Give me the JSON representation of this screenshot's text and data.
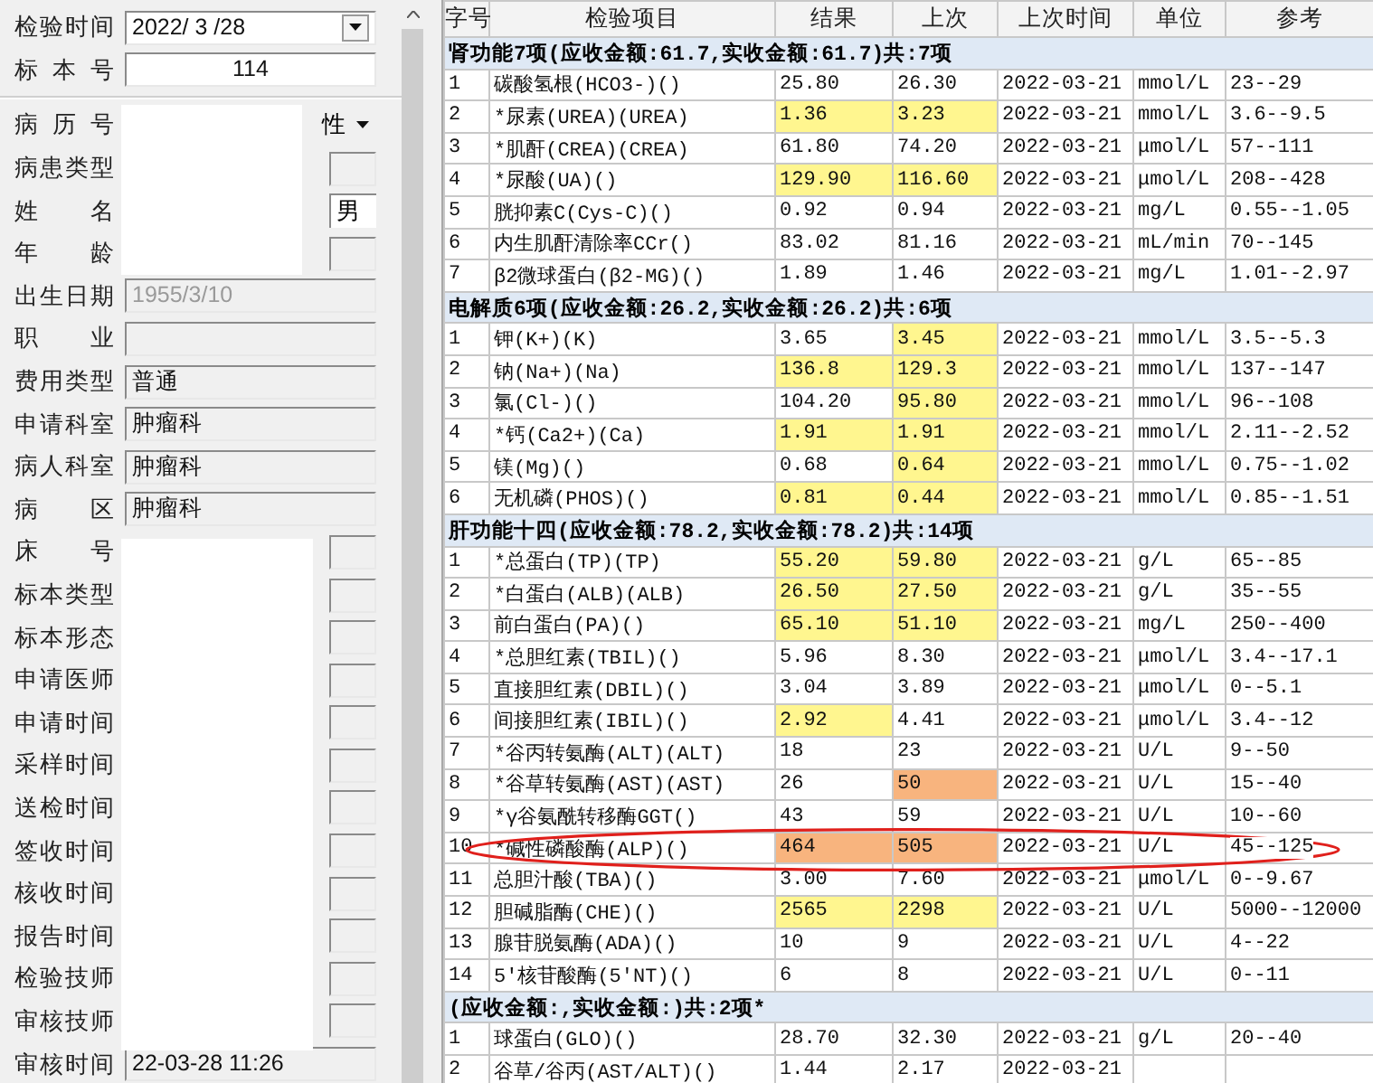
{
  "form": {
    "header_fields": [
      {
        "label": "检验时间",
        "value": "2022/ 3 /28",
        "kind": "dropdown"
      },
      {
        "label": "标 本 号",
        "value": "114",
        "kind": "number"
      }
    ],
    "fields": [
      {
        "label": "病 历 号",
        "kind": "sex_select",
        "sex_label": "性"
      },
      {
        "label": "病患类型",
        "kind": "redacted"
      },
      {
        "label": "姓 名",
        "kind": "name",
        "sex": "男"
      },
      {
        "label": "年 龄",
        "kind": "redacted"
      },
      {
        "label": "出生日期",
        "value": "1955/3/10",
        "kind": "disabled"
      },
      {
        "label": "职 业",
        "kind": "readonly"
      },
      {
        "label": "费用类型",
        "value": "普通",
        "kind": "readonly"
      },
      {
        "label": "申请科室",
        "value": "肿瘤科",
        "kind": "readonly"
      },
      {
        "label": "病人科室",
        "value": "肿瘤科",
        "kind": "readonly"
      },
      {
        "label": "病 区",
        "value": "肿瘤科",
        "kind": "readonly"
      },
      {
        "label": "床 号",
        "kind": "redacted"
      },
      {
        "label": "标本类型",
        "kind": "redacted"
      },
      {
        "label": "标本形态",
        "kind": "redacted"
      },
      {
        "label": "申请医师",
        "kind": "redacted"
      },
      {
        "label": "申请时间",
        "kind": "redacted"
      },
      {
        "label": "采样时间",
        "kind": "redacted"
      },
      {
        "label": "送检时间",
        "kind": "redacted"
      },
      {
        "label": "签收时间",
        "kind": "redacted"
      },
      {
        "label": "核收时间",
        "kind": "redacted"
      },
      {
        "label": "报告时间",
        "kind": "redacted"
      },
      {
        "label": "检验技师",
        "kind": "redacted"
      },
      {
        "label": "审核技师",
        "kind": "redacted"
      },
      {
        "label": "审核时间",
        "value": "22-03-28 11:26",
        "kind": "readonly"
      }
    ]
  },
  "table": {
    "columns": [
      "字号",
      "检验项目",
      "结果",
      "上次",
      "上次时间",
      "单位",
      "参考"
    ],
    "groups": [
      {
        "title": "肾功能7项(应收金额:61.7,实收金额:61.7)共:7项",
        "rows": [
          {
            "no": "1",
            "item": "碳酸氢根(HCO3-)()",
            "result": {
              "text": "25.80",
              "color": "#ffffff"
            },
            "previous": {
              "text": "26.30",
              "color": "#ffffff"
            },
            "previous_time": "2022-03-21",
            "unit": "mmol/L",
            "reference": "23--29",
            "circled": false
          },
          {
            "no": "2",
            "item": "*尿素(UREA)(UREA)",
            "result": {
              "text": "1.36",
              "color": "#fff68f"
            },
            "previous": {
              "text": "3.23",
              "color": "#fff68f"
            },
            "previous_time": "2022-03-21",
            "unit": "mmol/L",
            "reference": "3.6--9.5",
            "circled": false
          },
          {
            "no": "3",
            "item": "*肌酐(CREA)(CREA)",
            "result": {
              "text": "61.80",
              "color": "#ffffff"
            },
            "previous": {
              "text": "74.20",
              "color": "#ffffff"
            },
            "previous_time": "2022-03-21",
            "unit": "μmol/L",
            "reference": "57--111",
            "circled": false
          },
          {
            "no": "4",
            "item": "*尿酸(UA)()",
            "result": {
              "text": "129.90",
              "color": "#fff68f"
            },
            "previous": {
              "text": "116.60",
              "color": "#fff68f"
            },
            "previous_time": "2022-03-21",
            "unit": "μmol/L",
            "reference": "208--428",
            "circled": false
          },
          {
            "no": "5",
            "item": "胱抑素C(Cys-C)()",
            "result": {
              "text": "0.92",
              "color": "#ffffff"
            },
            "previous": {
              "text": "0.94",
              "color": "#ffffff"
            },
            "previous_time": "2022-03-21",
            "unit": "mg/L",
            "reference": "0.55--1.05",
            "circled": false
          },
          {
            "no": "6",
            "item": "内生肌酐清除率CCr()",
            "result": {
              "text": "83.02",
              "color": "#ffffff"
            },
            "previous": {
              "text": "81.16",
              "color": "#ffffff"
            },
            "previous_time": "2022-03-21",
            "unit": "mL/min",
            "reference": "70--145",
            "circled": false
          },
          {
            "no": "7",
            "item": "β2微球蛋白(β2-MG)()",
            "result": {
              "text": "1.89",
              "color": "#ffffff"
            },
            "previous": {
              "text": "1.46",
              "color": "#ffffff"
            },
            "previous_time": "2022-03-21",
            "unit": "mg/L",
            "reference": "1.01--2.97",
            "circled": false
          }
        ]
      },
      {
        "title": "电解质6项(应收金额:26.2,实收金额:26.2)共:6项",
        "rows": [
          {
            "no": "1",
            "item": "钾(K+)(K)",
            "result": {
              "text": "3.65",
              "color": "#ffffff"
            },
            "previous": {
              "text": "3.45",
              "color": "#fff68f"
            },
            "previous_time": "2022-03-21",
            "unit": "mmol/L",
            "reference": "3.5--5.3",
            "circled": false
          },
          {
            "no": "2",
            "item": "钠(Na+)(Na)",
            "result": {
              "text": "136.8",
              "color": "#fff68f"
            },
            "previous": {
              "text": "129.3",
              "color": "#fff68f"
            },
            "previous_time": "2022-03-21",
            "unit": "mmol/L",
            "reference": "137--147",
            "circled": false
          },
          {
            "no": "3",
            "item": "氯(Cl-)()",
            "result": {
              "text": "104.20",
              "color": "#ffffff"
            },
            "previous": {
              "text": "95.80",
              "color": "#fff68f"
            },
            "previous_time": "2022-03-21",
            "unit": "mmol/L",
            "reference": "96--108",
            "circled": false
          },
          {
            "no": "4",
            "item": "*钙(Ca2+)(Ca)",
            "result": {
              "text": "1.91",
              "color": "#fff68f"
            },
            "previous": {
              "text": "1.91",
              "color": "#fff68f"
            },
            "previous_time": "2022-03-21",
            "unit": "mmol/L",
            "reference": "2.11--2.52",
            "circled": false
          },
          {
            "no": "5",
            "item": "镁(Mg)()",
            "result": {
              "text": "0.68",
              "color": "#ffffff"
            },
            "previous": {
              "text": "0.64",
              "color": "#fff68f"
            },
            "previous_time": "2022-03-21",
            "unit": "mmol/L",
            "reference": "0.75--1.02",
            "circled": false
          },
          {
            "no": "6",
            "item": "无机磷(PHOS)()",
            "result": {
              "text": "0.81",
              "color": "#fff68f"
            },
            "previous": {
              "text": "0.44",
              "color": "#fff68f"
            },
            "previous_time": "2022-03-21",
            "unit": "mmol/L",
            "reference": "0.85--1.51",
            "circled": false
          }
        ]
      },
      {
        "title": "肝功能十四(应收金额:78.2,实收金额:78.2)共:14项",
        "rows": [
          {
            "no": "1",
            "item": "*总蛋白(TP)(TP)",
            "result": {
              "text": "55.20",
              "color": "#fff68f"
            },
            "previous": {
              "text": "59.80",
              "color": "#fff68f"
            },
            "previous_time": "2022-03-21",
            "unit": "g/L",
            "reference": "65--85",
            "circled": false
          },
          {
            "no": "2",
            "item": "*白蛋白(ALB)(ALB)",
            "result": {
              "text": "26.50",
              "color": "#fff68f"
            },
            "previous": {
              "text": "27.50",
              "color": "#fff68f"
            },
            "previous_time": "2022-03-21",
            "unit": "g/L",
            "reference": "35--55",
            "circled": false
          },
          {
            "no": "3",
            "item": "前白蛋白(PA)()",
            "result": {
              "text": "65.10",
              "color": "#fff68f"
            },
            "previous": {
              "text": "51.10",
              "color": "#fff68f"
            },
            "previous_time": "2022-03-21",
            "unit": "mg/L",
            "reference": "250--400",
            "circled": false
          },
          {
            "no": "4",
            "item": "*总胆红素(TBIL)()",
            "result": {
              "text": "5.96",
              "color": "#ffffff"
            },
            "previous": {
              "text": "8.30",
              "color": "#ffffff"
            },
            "previous_time": "2022-03-21",
            "unit": "μmol/L",
            "reference": "3.4--17.1",
            "circled": false
          },
          {
            "no": "5",
            "item": "直接胆红素(DBIL)()",
            "result": {
              "text": "3.04",
              "color": "#ffffff"
            },
            "previous": {
              "text": "3.89",
              "color": "#ffffff"
            },
            "previous_time": "2022-03-21",
            "unit": "μmol/L",
            "reference": "0--5.1",
            "circled": false
          },
          {
            "no": "6",
            "item": "间接胆红素(IBIL)()",
            "result": {
              "text": "2.92",
              "color": "#fff68f"
            },
            "previous": {
              "text": "4.41",
              "color": "#ffffff"
            },
            "previous_time": "2022-03-21",
            "unit": "μmol/L",
            "reference": "3.4--12",
            "circled": false
          },
          {
            "no": "7",
            "item": "*谷丙转氨酶(ALT)(ALT)",
            "result": {
              "text": "18",
              "color": "#ffffff"
            },
            "previous": {
              "text": "23",
              "color": "#ffffff"
            },
            "previous_time": "2022-03-21",
            "unit": "U/L",
            "reference": "9--50",
            "circled": false
          },
          {
            "no": "8",
            "item": "*谷草转氨酶(AST)(AST)",
            "result": {
              "text": "26",
              "color": "#ffffff"
            },
            "previous": {
              "text": "50",
              "color": "#f8b47e"
            },
            "previous_time": "2022-03-21",
            "unit": "U/L",
            "reference": "15--40",
            "circled": false
          },
          {
            "no": "9",
            "item": "*γ谷氨酰转移酶GGT()",
            "result": {
              "text": "43",
              "color": "#ffffff"
            },
            "previous": {
              "text": "59",
              "color": "#ffffff"
            },
            "previous_time": "2022-03-21",
            "unit": "U/L",
            "reference": "10--60",
            "circled": false
          },
          {
            "no": "10",
            "item": "*碱性磷酸酶(ALP)()",
            "result": {
              "text": "464",
              "color": "#f8b47e"
            },
            "previous": {
              "text": "505",
              "color": "#f8b47e"
            },
            "previous_time": "2022-03-21",
            "unit": "U/L",
            "reference": "45--125",
            "circled": true
          },
          {
            "no": "11",
            "item": "总胆汁酸(TBA)()",
            "result": {
              "text": "3.00",
              "color": "#ffffff"
            },
            "previous": {
              "text": "7.60",
              "color": "#ffffff"
            },
            "previous_time": "2022-03-21",
            "unit": "μmol/L",
            "reference": "0--9.67",
            "circled": false
          },
          {
            "no": "12",
            "item": "胆碱脂酶(CHE)()",
            "result": {
              "text": "2565",
              "color": "#fff68f"
            },
            "previous": {
              "text": "2298",
              "color": "#fff68f"
            },
            "previous_time": "2022-03-21",
            "unit": "U/L",
            "reference": "5000--12000",
            "circled": false
          },
          {
            "no": "13",
            "item": "腺苷脱氨酶(ADA)()",
            "result": {
              "text": "10",
              "color": "#ffffff"
            },
            "previous": {
              "text": "9",
              "color": "#ffffff"
            },
            "previous_time": "2022-03-21",
            "unit": "U/L",
            "reference": "4--22",
            "circled": false
          },
          {
            "no": "14",
            "item": "5′核苷酸酶(5′NT)()",
            "result": {
              "text": "6",
              "color": "#ffffff"
            },
            "previous": {
              "text": "8",
              "color": "#ffffff"
            },
            "previous_time": "2022-03-21",
            "unit": "U/L",
            "reference": "0--11",
            "circled": false
          }
        ]
      },
      {
        "title": "(应收金额:,实收金额:)共:2项*",
        "rows": [
          {
            "no": "1",
            "item": "球蛋白(GLO)()",
            "result": {
              "text": "28.70",
              "color": "#ffffff"
            },
            "previous": {
              "text": "32.30",
              "color": "#ffffff"
            },
            "previous_time": "2022-03-21",
            "unit": "g/L",
            "reference": "20--40",
            "circled": false
          },
          {
            "no": "2",
            "item": "谷草/谷丙(AST/ALT)()",
            "result": {
              "text": "1.44",
              "color": "#ffffff"
            },
            "previous": {
              "text": "2.17",
              "color": "#ffffff"
            },
            "previous_time": "2022-03-21",
            "circled": false
          }
        ]
      }
    ]
  }
}
